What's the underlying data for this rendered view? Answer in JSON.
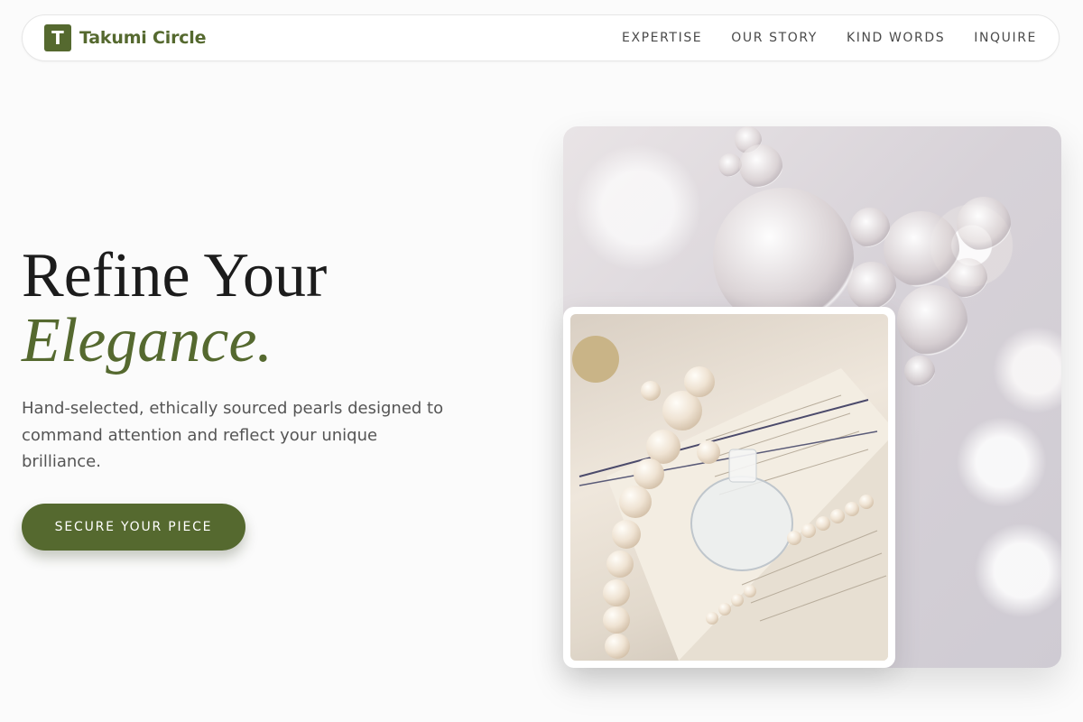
{
  "header": {
    "brand_letter": "T",
    "brand_name": "Takumi Circle",
    "nav": [
      {
        "label": "EXPERTISE"
      },
      {
        "label": "OUR STORY"
      },
      {
        "label": "KIND WORDS"
      },
      {
        "label": "INQUIRE"
      }
    ]
  },
  "hero": {
    "title_line1": "Refine Your",
    "title_line2": "Elegance.",
    "subtitle": "Hand-selected, ethically sourced pearls designed to command attention and reflect your unique brilliance.",
    "cta_label": "SECURE YOUR PIECE"
  },
  "colors": {
    "brand": "#55692f",
    "background": "#fbfbfb"
  }
}
